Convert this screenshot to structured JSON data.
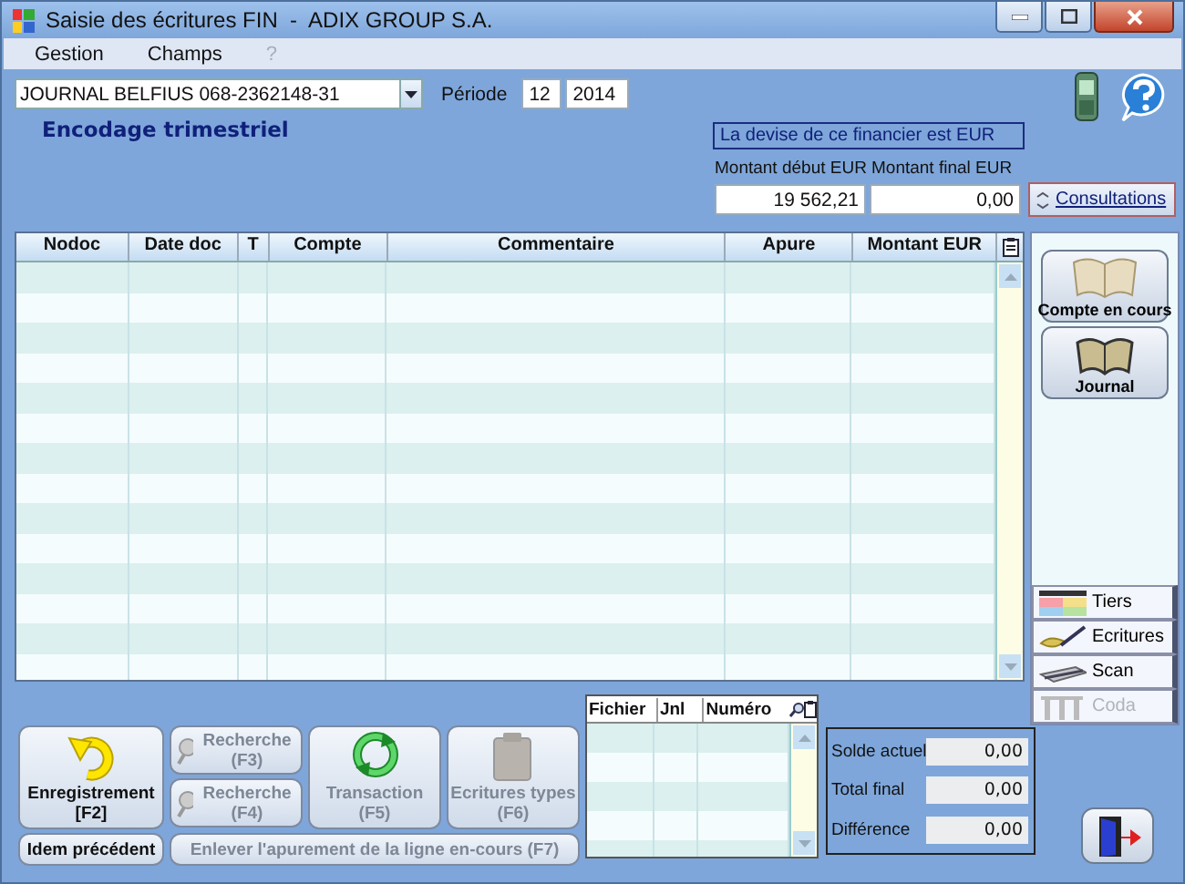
{
  "window": {
    "title": "Saisie des écritures FIN  -  ADIX GROUP S.A."
  },
  "menu": [
    {
      "label": "Gestion",
      "disabled": false
    },
    {
      "label": "Champs",
      "disabled": false
    },
    {
      "label": "?",
      "disabled": true
    }
  ],
  "journal": {
    "value": "JOURNAL BELFIUS 068-2362148-31"
  },
  "period": {
    "label": "Période",
    "month": "12",
    "year": "2014"
  },
  "heading": "Encodage trimestriel",
  "currency_note": "La devise de ce financier est EUR",
  "amounts": [
    {
      "label": "Montant début EUR",
      "value": "19 562,21"
    },
    {
      "label": "Montant final EUR",
      "value": "0,00"
    }
  ],
  "consultations": {
    "label": "Consultations"
  },
  "table": {
    "columns": [
      "Nodoc",
      "Date doc",
      "T",
      "Compte",
      "Commentaire",
      "Apure",
      "Montant EUR"
    ]
  },
  "side_buttons": [
    {
      "label": "Compte en cours",
      "kind": "open-book"
    },
    {
      "label": "Journal",
      "kind": "book"
    }
  ],
  "side_tabs": [
    {
      "label": "Tiers",
      "kind": "tiers",
      "disabled": false
    },
    {
      "label": "Ecritures",
      "kind": "pen",
      "disabled": false
    },
    {
      "label": "Scan",
      "kind": "scan",
      "disabled": false
    },
    {
      "label": "Coda",
      "kind": "coda",
      "disabled": true
    }
  ],
  "actions": [
    {
      "kind": "save",
      "label": "Enregistrement",
      "key": "[F2]",
      "disabled": false
    },
    {
      "kind": "stack",
      "items": [
        {
          "label": "Recherche",
          "key": "(F3)",
          "disabled": true
        },
        {
          "label": "Recherche",
          "key": "(F4)",
          "disabled": true
        }
      ]
    },
    {
      "kind": "transaction",
      "label": "Transaction",
      "key": "(F5)",
      "disabled": true
    },
    {
      "kind": "templates",
      "label": "Ecritures types",
      "key": "(F6)",
      "disabled": true
    }
  ],
  "bottom_actions": [
    {
      "label": "Idem précédent",
      "disabled": false
    },
    {
      "label": "Enlever l'apurement de la ligne en-cours (F7)",
      "disabled": true
    }
  ],
  "sub_table": {
    "columns": [
      "Fichier",
      "Jnl",
      "Numéro"
    ]
  },
  "totals": [
    {
      "label": "Solde actuel",
      "value": "0,00"
    },
    {
      "label": "Total final",
      "value": "0,00"
    },
    {
      "label": "Différence",
      "value": "0,00"
    }
  ]
}
